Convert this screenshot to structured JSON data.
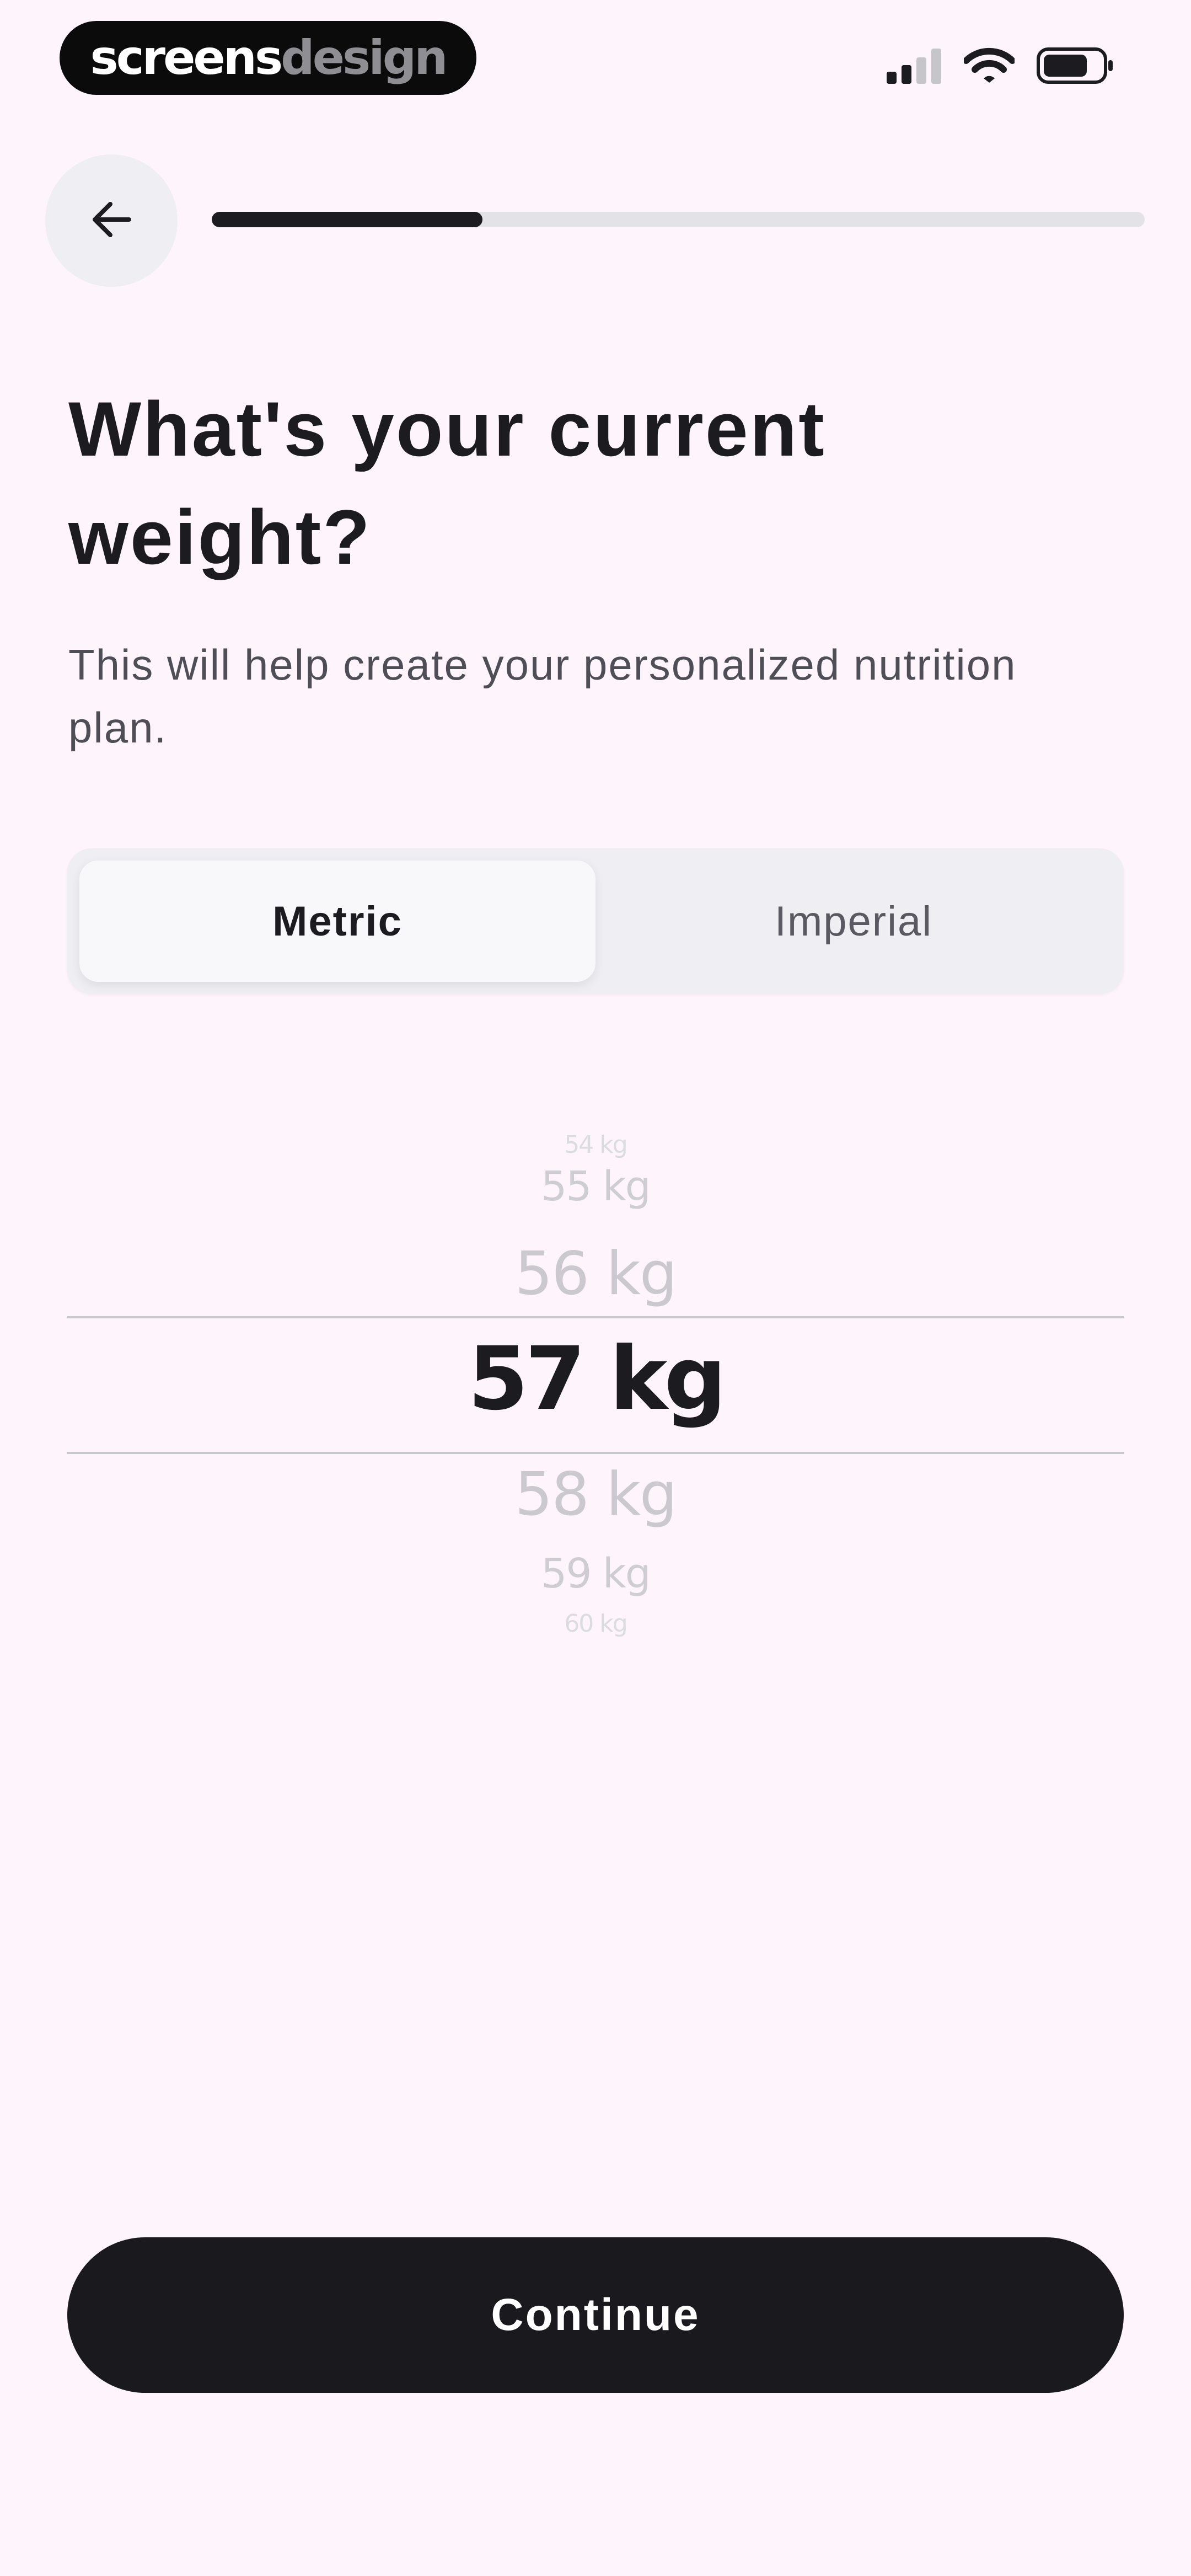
{
  "status_bar": {
    "brand_part1": "screens",
    "brand_part2": "design"
  },
  "icons": {
    "signal": "cellular-signal-icon",
    "wifi": "wifi-icon",
    "battery": "battery-icon",
    "back": "arrow-left-icon"
  },
  "progress": {
    "value": 0.29
  },
  "header": {
    "title": "What's your current weight?",
    "subtitle": "This will help create your personalized nutrition plan."
  },
  "unit_toggle": {
    "options": [
      "Metric",
      "Imperial"
    ],
    "selected": "Metric"
  },
  "picker": {
    "values": [
      "54 kg",
      "55 kg",
      "56 kg",
      "57 kg",
      "58 kg",
      "59 kg",
      "60 kg"
    ],
    "selected": "57 kg"
  },
  "footer": {
    "continue_label": "Continue"
  },
  "colors": {
    "background": "#fdf4fc",
    "primary": "#1a191d",
    "track": "#e3e2e7"
  }
}
